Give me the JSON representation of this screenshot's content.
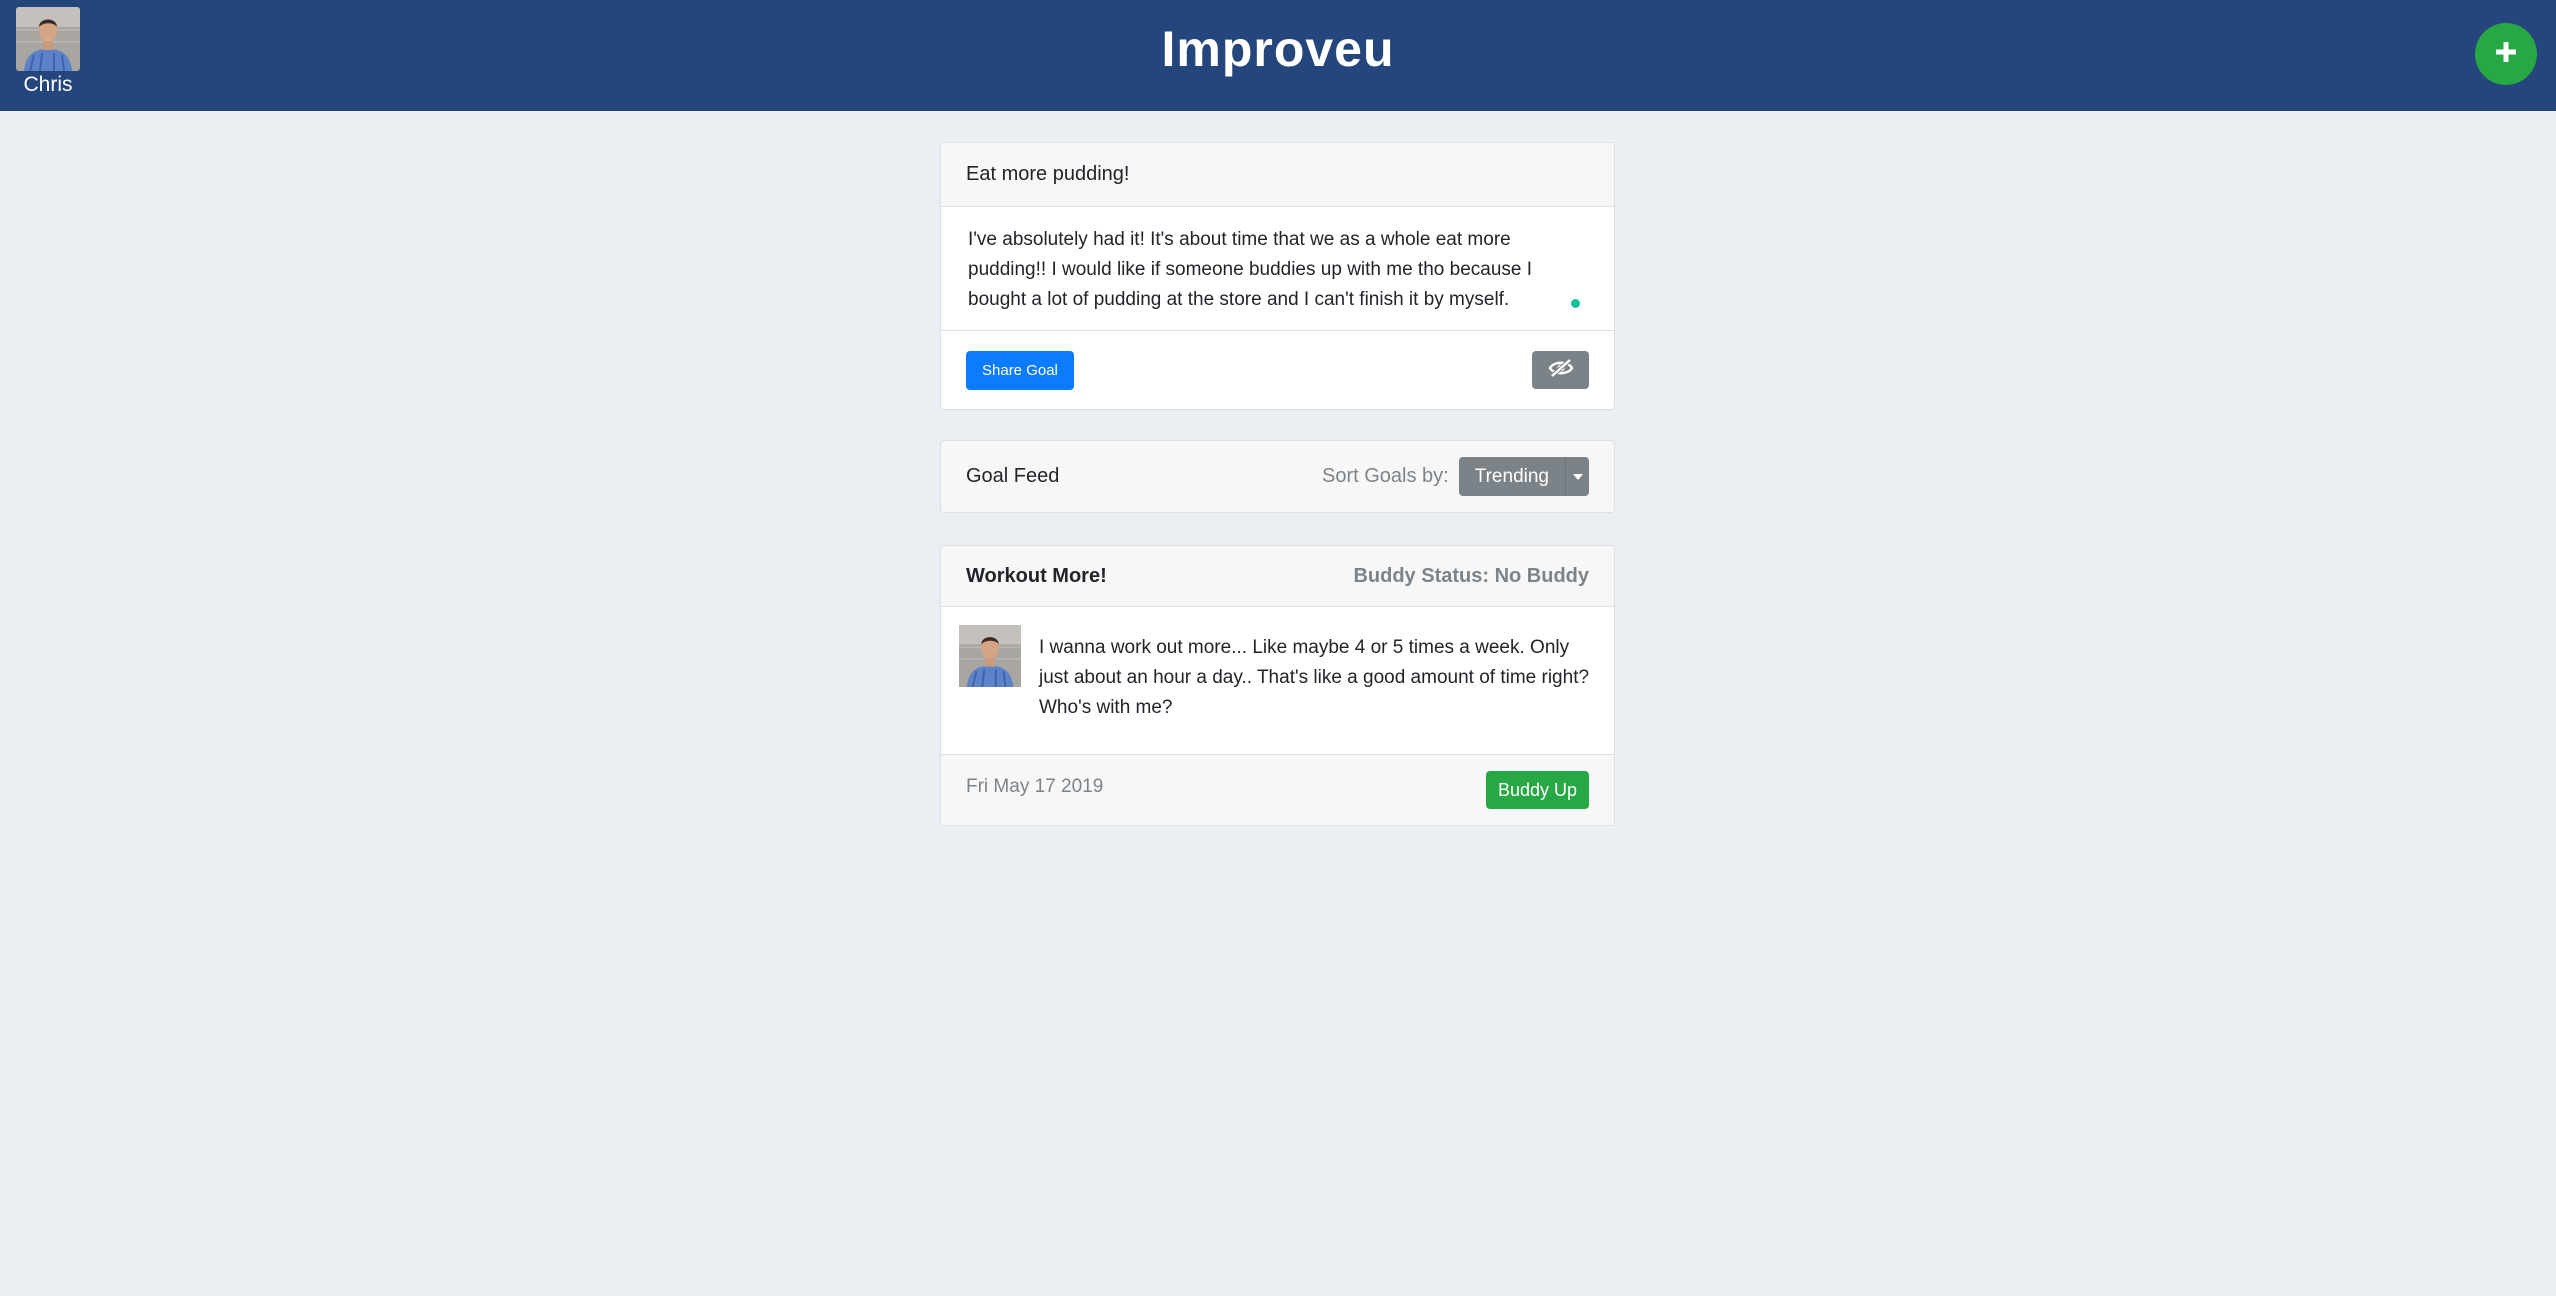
{
  "header": {
    "brand": "Improveu",
    "user_name": "Chris",
    "add_button_icon": "plus-icon"
  },
  "compose": {
    "title_value": "Eat more pudding!",
    "body_value": "I've absolutely had it! It's about time that we as a whole eat more pudding!! I would like if someone buddies up with me tho because I bought a lot of pudding at the store and I can't finish it by myself.",
    "share_label": "Share Goal",
    "visibility_icon": "eye-slash-icon"
  },
  "feed": {
    "title": "Goal Feed",
    "sort_label": "Sort Goals by:",
    "sort_value": "Trending"
  },
  "goals": [
    {
      "title": "Workout More!",
      "buddy_status": "Buddy Status: No Buddy",
      "body": "I wanna work out more... Like maybe 4 or 5 times a week. Only just about an hour a day.. That's like a good amount of time right? Who's with me?",
      "date": "Fri May 17 2019",
      "action_label": "Buddy Up"
    }
  ],
  "colors": {
    "navbar": "#25467d",
    "primary": "#0b7bff",
    "success": "#28a745",
    "secondary": "#7b8389",
    "background": "#ebeef3"
  }
}
